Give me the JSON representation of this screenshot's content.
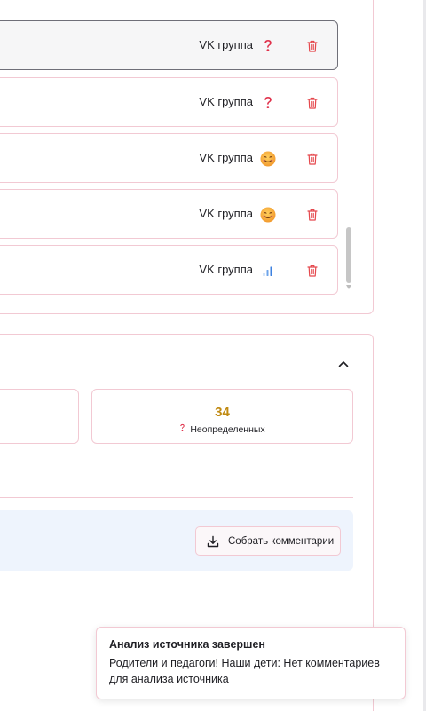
{
  "sources": {
    "rows": [
      {
        "type_label": "VK группа",
        "status_icon": "question-icon",
        "selected": true
      },
      {
        "type_label": "VK группа",
        "status_icon": "question-icon",
        "selected": false
      },
      {
        "type_label": "VK группа",
        "status_icon": "smile-emoji-icon",
        "selected": false
      },
      {
        "type_label": "VK группа",
        "status_icon": "smile-emoji-icon",
        "selected": false
      },
      {
        "type_label": "VK группа",
        "status_icon": "signal-bars-icon",
        "selected": false
      }
    ]
  },
  "stats": {
    "undefined_value": "34",
    "undefined_label": "Неопределенных"
  },
  "actions": {
    "collect_comments_label": "Собрать комментарии"
  },
  "toast": {
    "title": "Анализ источника завершен",
    "message": "Родители и педагоги! Наши дети: Нет комментариев для анализа источника"
  },
  "colors": {
    "accent_pink": "#f2c9d3",
    "value_gold": "#c08a12",
    "delete_red": "#e5484d",
    "info_blue_bg": "#eef4fd"
  }
}
